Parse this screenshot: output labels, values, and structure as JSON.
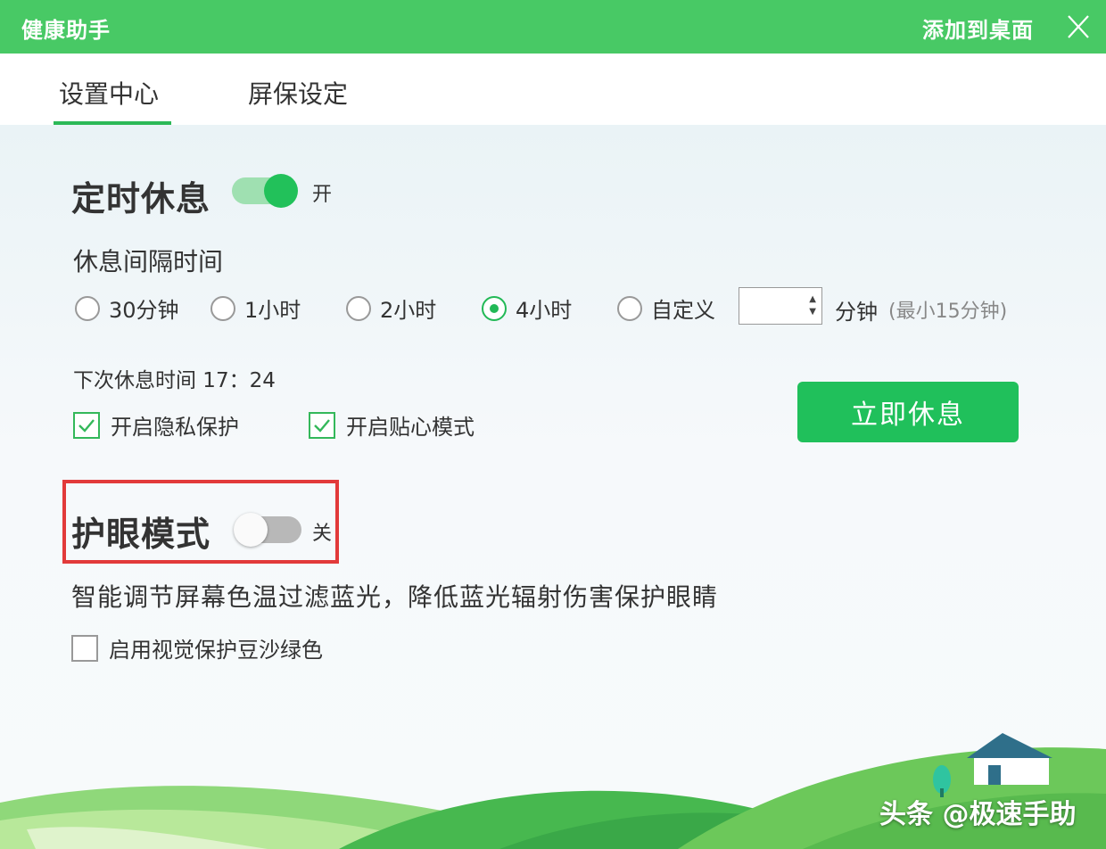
{
  "titlebar": {
    "app_title": "健康助手",
    "add_desktop": "添加到桌面",
    "accent": "#48c965"
  },
  "tabs": [
    {
      "label": "设置中心",
      "active": true
    },
    {
      "label": "屏保设定",
      "active": false
    }
  ],
  "timed_rest": {
    "title": "定时休息",
    "toggle_state": "开",
    "enabled": true,
    "interval_label": "休息间隔时间",
    "options": [
      {
        "label": "30分钟",
        "checked": false
      },
      {
        "label": "1小时",
        "checked": false
      },
      {
        "label": "2小时",
        "checked": false
      },
      {
        "label": "4小时",
        "checked": true
      },
      {
        "label": "自定义",
        "checked": false
      }
    ],
    "custom_minutes_value": "",
    "minutes_unit": "分钟",
    "min_hint": "(最小15分钟)",
    "next_rest": "下次休息时间 17：24",
    "privacy_label": "开启隐私保护",
    "privacy_checked": true,
    "caring_label": "开启贴心模式",
    "caring_checked": true,
    "rest_now_button": "立即休息"
  },
  "eye_mode": {
    "title": "护眼模式",
    "toggle_state": "关",
    "enabled": false,
    "description": "智能调节屏幕色温过滤蓝光，降低蓝光辐射伤害保护眼睛",
    "green_label": "启用视觉保护豆沙绿色",
    "green_checked": false
  },
  "watermark": "头条 @极速手助",
  "colors": {
    "primary_green": "#20c05b",
    "highlight_red": "#e23a3a"
  }
}
